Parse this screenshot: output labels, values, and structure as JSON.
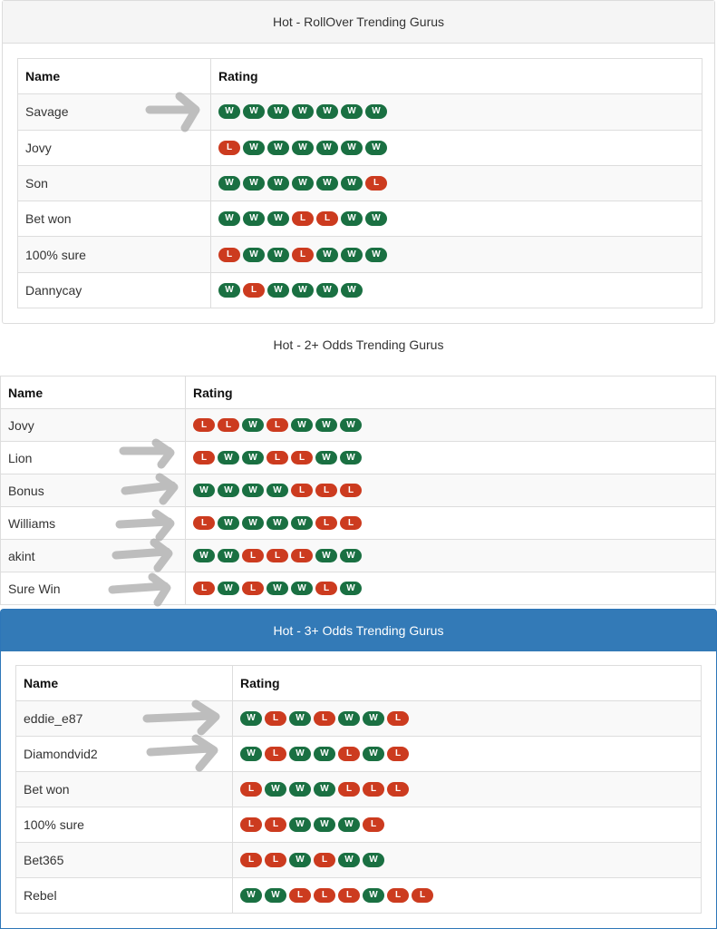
{
  "colors": {
    "win": "#1a7042",
    "loss": "#cc3b1f",
    "primary": "#337ab7"
  },
  "panels": [
    {
      "title": "Hot - RollOver Trending Gurus",
      "headers": [
        "Name",
        "Rating"
      ],
      "rows": [
        {
          "name": "Savage",
          "rating": [
            "W",
            "W",
            "W",
            "W",
            "W",
            "W",
            "W"
          ]
        },
        {
          "name": "Jovy",
          "rating": [
            "L",
            "W",
            "W",
            "W",
            "W",
            "W",
            "W"
          ]
        },
        {
          "name": "Son",
          "rating": [
            "W",
            "W",
            "W",
            "W",
            "W",
            "W",
            "L"
          ]
        },
        {
          "name": "Bet won",
          "rating": [
            "W",
            "W",
            "W",
            "L",
            "L",
            "W",
            "W"
          ]
        },
        {
          "name": "100% sure",
          "rating": [
            "L",
            "W",
            "W",
            "L",
            "W",
            "W",
            "W"
          ]
        },
        {
          "name": "Dannycay",
          "rating": [
            "W",
            "L",
            "W",
            "W",
            "W",
            "W"
          ]
        }
      ]
    },
    {
      "title": "Hot - 2+ Odds Trending Gurus",
      "headers": [
        "Name",
        "Rating"
      ],
      "rows": [
        {
          "name": "Jovy",
          "rating": [
            "L",
            "L",
            "W",
            "L",
            "W",
            "W",
            "W"
          ]
        },
        {
          "name": "Lion",
          "rating": [
            "L",
            "W",
            "W",
            "L",
            "L",
            "W",
            "W"
          ]
        },
        {
          "name": "Bonus",
          "rating": [
            "W",
            "W",
            "W",
            "W",
            "L",
            "L",
            "L"
          ]
        },
        {
          "name": "Williams",
          "rating": [
            "L",
            "W",
            "W",
            "W",
            "W",
            "L",
            "L"
          ]
        },
        {
          "name": "akint",
          "rating": [
            "W",
            "W",
            "L",
            "L",
            "L",
            "W",
            "W"
          ]
        },
        {
          "name": "Sure Win",
          "rating": [
            "L",
            "W",
            "L",
            "W",
            "W",
            "L",
            "W"
          ]
        }
      ]
    },
    {
      "title": "Hot - 3+ Odds Trending Gurus",
      "headers": [
        "Name",
        "Rating"
      ],
      "rows": [
        {
          "name": "eddie_e87",
          "rating": [
            "W",
            "L",
            "W",
            "L",
            "W",
            "W",
            "L"
          ]
        },
        {
          "name": "Diamondvid2",
          "rating": [
            "W",
            "L",
            "W",
            "W",
            "L",
            "W",
            "L"
          ]
        },
        {
          "name": "Bet won",
          "rating": [
            "L",
            "W",
            "W",
            "W",
            "L",
            "L",
            "L"
          ]
        },
        {
          "name": "100% sure",
          "rating": [
            "L",
            "L",
            "W",
            "W",
            "W",
            "L"
          ]
        },
        {
          "name": "Bet365",
          "rating": [
            "L",
            "L",
            "W",
            "L",
            "W",
            "W"
          ]
        },
        {
          "name": "Rebel",
          "rating": [
            "W",
            "W",
            "L",
            "L",
            "L",
            "W",
            "L",
            "L"
          ]
        }
      ]
    }
  ]
}
